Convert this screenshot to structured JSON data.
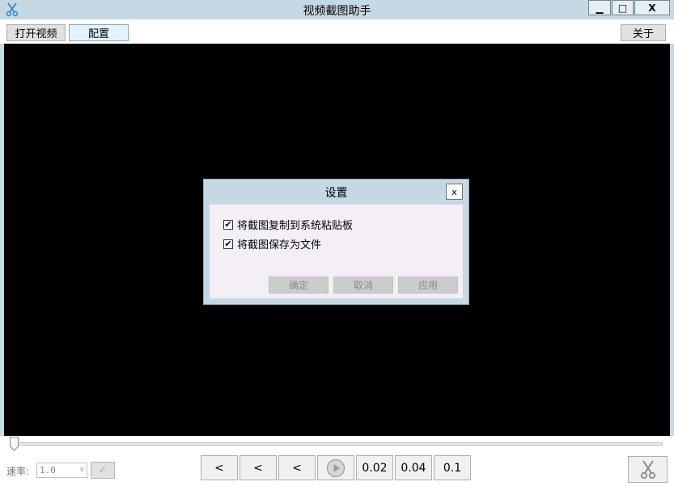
{
  "window": {
    "title": "视频截图助手",
    "min_glyph": "▁",
    "max_glyph": "□",
    "close_glyph": "X"
  },
  "toolbar": {
    "open_video": "打开视频",
    "config": "配置",
    "about": "关于"
  },
  "dialog": {
    "title": "设置",
    "close_glyph": "x",
    "options": [
      {
        "label": "将截图复制到系统粘贴板",
        "checked": true
      },
      {
        "label": "将截图保存为文件",
        "checked": true
      }
    ],
    "check_glyph": "✔",
    "buttons": {
      "ok": "确定",
      "cancel": "取消",
      "apply": "应用"
    }
  },
  "player": {
    "progress": 0,
    "speed_label": "速率:",
    "speed_value": "1.0",
    "speed_arrow": "∨",
    "confirm_glyph": "✓",
    "step_buttons": [
      "<",
      "<",
      "<"
    ],
    "interval_buttons": [
      "0.02",
      "0.04",
      "0.1"
    ]
  },
  "colors": {
    "chrome": "#c5d8e3",
    "video_bg": "#000000",
    "dialog_body": "#f4eff6",
    "icon_accent": "#2c7fc9"
  }
}
